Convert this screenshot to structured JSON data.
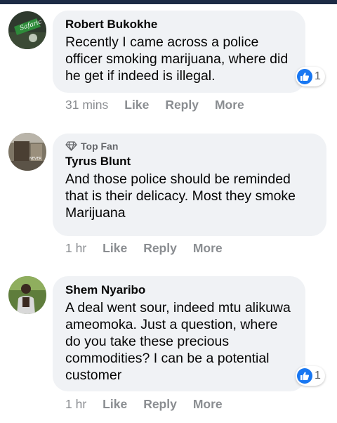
{
  "comments": [
    {
      "author": "Robert Bukokhe",
      "badge": "",
      "text": "Recently I came across a police officer smoking marijuana, where did he get if indeed is illegal.",
      "time": "31 mins",
      "actions": [
        "Like",
        "Reply",
        "More"
      ],
      "reaction_count": "1",
      "avatar_text": "Safaric"
    },
    {
      "author": "Tyrus Blunt",
      "badge": "Top Fan",
      "text": "And those police should be reminded that is their delicacy. Most they smoke Marijuana",
      "time": "1 hr",
      "actions": [
        "Like",
        "Reply",
        "More"
      ],
      "reaction_count": "",
      "avatar_text": "NEVER"
    },
    {
      "author": "Shem Nyaribo",
      "badge": "",
      "text": "A deal went sour, indeed mtu alikuwa ameomoka. Just a question, where do you take these precious commodities? I can be a potential customer",
      "time": "1 hr",
      "actions": [
        "Like",
        "Reply",
        "More"
      ],
      "reaction_count": "1",
      "avatar_text": ""
    }
  ],
  "colors": {
    "bubble": "#f0f2f5",
    "meta": "#8a8d91",
    "like_blue": "#1877f2",
    "topbar": "#1d2b45"
  }
}
